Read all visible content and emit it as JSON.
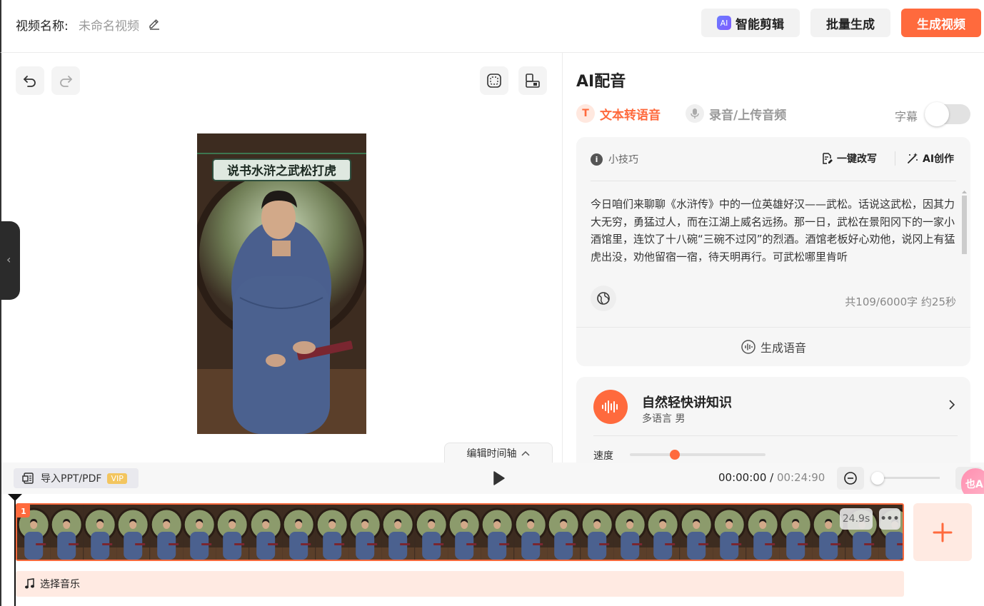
{
  "header": {
    "title_label": "视频名称:",
    "title_value": "未命名视频",
    "ai_badge": "AI",
    "ai_edit_label": "智能剪辑",
    "batch_label": "批量生成",
    "generate_label": "生成视频"
  },
  "preview": {
    "video_caption": "说书水浒之武松打虎",
    "edit_timeline_label": "编辑时间轴"
  },
  "panel": {
    "title": "AI配音",
    "tab_tts": "文本转语音",
    "tab_tts_icon": "T",
    "tab_record": "录音/上传音频",
    "subtitle_label": "字幕",
    "subtitle_on": false,
    "tip_label": "小技巧",
    "rewrite_label": "一键改写",
    "ai_create_label": "AI创作",
    "script_text": "今日咱们来聊聊《水浒传》中的一位英雄好汉——武松。话说这武松，因其力大无穷，勇猛过人，而在江湖上威名远扬。那一日，武松在景阳冈下的一家小酒馆里，连饮了十八碗“三碗不过冈”的烈酒。酒馆老板好心劝他，说冈上有猛虎出没，劝他留宿一宿，待天明再行。可武松哪里肯听",
    "char_count": "共109/6000字 约25秒",
    "generate_voice_label": "生成语音"
  },
  "voice": {
    "name": "自然轻快讲知识",
    "meta": "多语言  男",
    "speed_label": "速度",
    "speed_value": 0.33
  },
  "controls": {
    "import_label": "导入PPT/PDF",
    "vip_label": "VIP",
    "current_time": "00:00:00",
    "separator": " / ",
    "total_time": "00:24:90",
    "zoom_value": 0.0,
    "float_badge": "也A"
  },
  "timeline": {
    "clip_number": "1",
    "clip_duration": "24.9s",
    "clip_more": "•••",
    "music_label": "选择音乐",
    "thumbnail_count": 27
  },
  "colors": {
    "accent": "#ff6a3d",
    "accent_light": "#ffeae2"
  }
}
